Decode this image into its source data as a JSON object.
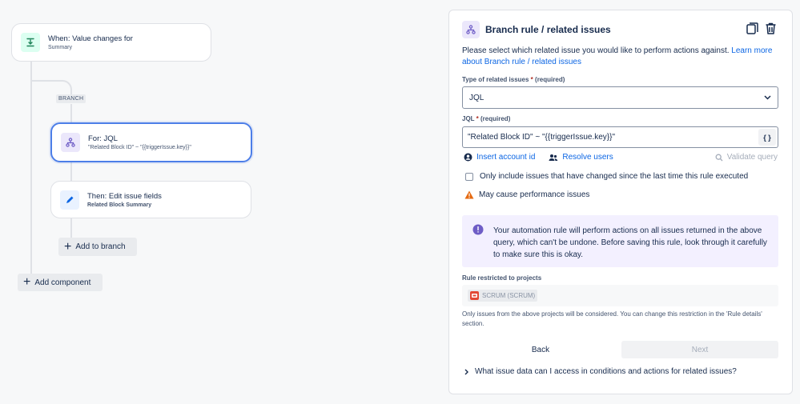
{
  "canvas": {
    "trigger": {
      "title": "When: Value changes for",
      "subtitle": "Summary"
    },
    "branch_tag": "BRANCH",
    "branch_card": {
      "title": "For: JQL",
      "subtitle": "\"Related Block ID\" ~ \"{{triggerIssue.key}}\""
    },
    "action_card": {
      "title": "Then: Edit issue fields",
      "subtitle": "Related Block Summary"
    },
    "add_to_branch": "Add to branch",
    "add_component": "Add component"
  },
  "panel": {
    "title": "Branch rule / related issues",
    "description": "Please select which related issue you would like to perform actions against.",
    "learn_more": "Learn more about Branch rule / related issues",
    "type_label": "Type of related issues",
    "required_star": "*",
    "required_text": "(required)",
    "type_value": "JQL",
    "jql_label": "JQL",
    "jql_value": "\"Related Block ID\" ~ \"{{triggerIssue.key}}\"",
    "jql_braces": "{ }",
    "insert_account": "Insert account id",
    "resolve_users": "Resolve users",
    "validate_query": "Validate query",
    "checkbox_label": "Only include issues that have changed since the last time this rule executed",
    "warning": "May cause performance issues",
    "info_text": "Your automation rule will perform actions on all issues returned in the above query, which can't be undone. Before saving this rule, look through it carefully to make sure this is okay.",
    "projects_label": "Rule restricted to projects",
    "project_chip": "SCRUM (SCRUM)",
    "projects_note": "Only issues from the above projects will be considered. You can change this restriction in the 'Rule details' section.",
    "back": "Back",
    "next": "Next",
    "faq": "What issue data can I access in conditions and actions for related issues?"
  },
  "colors": {
    "accent": "#0c66e4",
    "selected_border": "#4c7ee8",
    "trigger_icon_bg": "#dcfff1",
    "trigger_icon": "#1f845a",
    "branch_icon_bg": "#ebe7fb",
    "branch_icon": "#6e5dc6",
    "edit_icon_bg": "#e9f2ff",
    "edit_icon": "#0c66e4",
    "info_bg": "#f3f0ff",
    "warning": "#e56910"
  },
  "icons": [
    "trigger-icon",
    "branch-icon",
    "pencil-icon",
    "plus-icon",
    "copy-icon",
    "trash-icon",
    "chevron-down-icon",
    "user-circle-icon",
    "users-icon",
    "search-icon",
    "checkbox",
    "warning-icon",
    "info-icon",
    "project-icon",
    "chevron-right-icon"
  ]
}
